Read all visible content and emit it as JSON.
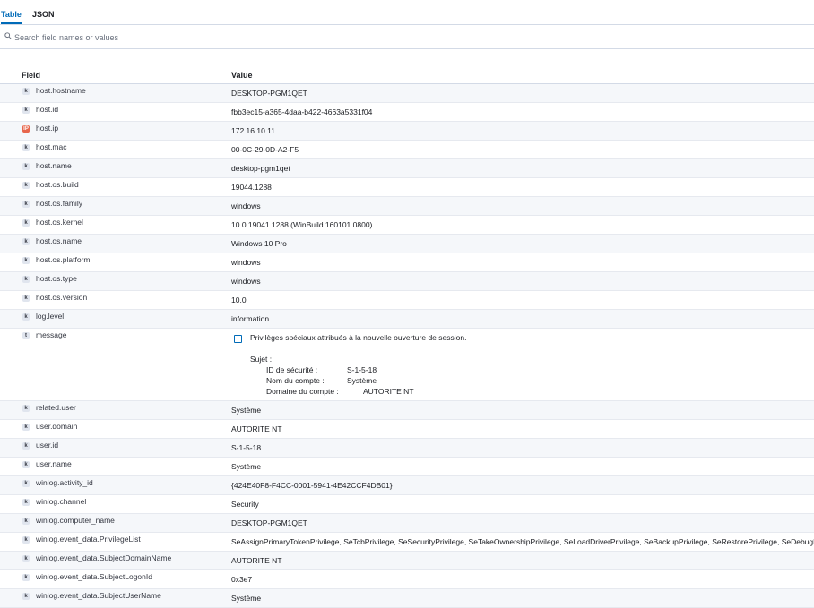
{
  "tabs": [
    {
      "label": "Table",
      "active": true
    },
    {
      "label": "JSON",
      "active": false
    }
  ],
  "search": {
    "placeholder": "Search field names or values",
    "icon": "search-icon"
  },
  "table": {
    "headers": {
      "field": "Field",
      "value": "Value"
    },
    "rows": [
      {
        "type": "k",
        "field": "host.hostname",
        "value": "DESKTOP-PGM1QET"
      },
      {
        "type": "k",
        "field": "host.id",
        "value": "fbb3ec15-a365-4daa-b422-4663a5331f04"
      },
      {
        "type": "IP",
        "field": "host.ip",
        "value": "172.16.10.11"
      },
      {
        "type": "k",
        "field": "host.mac",
        "value": "00-0C-29-0D-A2-F5"
      },
      {
        "type": "k",
        "field": "host.name",
        "value": "desktop-pgm1qet"
      },
      {
        "type": "k",
        "field": "host.os.build",
        "value": "19044.1288"
      },
      {
        "type": "k",
        "field": "host.os.family",
        "value": "windows"
      },
      {
        "type": "k",
        "field": "host.os.kernel",
        "value": "10.0.19041.1288 (WinBuild.160101.0800)"
      },
      {
        "type": "k",
        "field": "host.os.name",
        "value": "Windows 10 Pro"
      },
      {
        "type": "k",
        "field": "host.os.platform",
        "value": "windows"
      },
      {
        "type": "k",
        "field": "host.os.type",
        "value": "windows"
      },
      {
        "type": "k",
        "field": "host.os.version",
        "value": "10.0"
      },
      {
        "type": "k",
        "field": "log.level",
        "value": "information"
      }
    ],
    "message": {
      "type": "t",
      "field": "message",
      "line1": "Privilèges spéciaux attribués à la nouvelle ouverture de session.",
      "subject_label": "Sujet :",
      "entries": [
        {
          "label": "ID de sécurité :",
          "value": "S-1-5-18"
        },
        {
          "label": "Nom du compte :",
          "value": "Système"
        },
        {
          "label": "Domaine du compte :",
          "value": "AUTORITE NT"
        }
      ]
    },
    "rows2": [
      {
        "type": "k",
        "field": "related.user",
        "value": "Système"
      },
      {
        "type": "k",
        "field": "user.domain",
        "value": "AUTORITE NT"
      },
      {
        "type": "k",
        "field": "user.id",
        "value": "S-1-5-18"
      },
      {
        "type": "k",
        "field": "user.name",
        "value": "Système"
      },
      {
        "type": "k",
        "field": "winlog.activity_id",
        "value": "{424E40F8-F4CC-0001-5941-4E42CCF4DB01}"
      },
      {
        "type": "k",
        "field": "winlog.channel",
        "value": "Security"
      },
      {
        "type": "k",
        "field": "winlog.computer_name",
        "value": "DESKTOP-PGM1QET"
      },
      {
        "type": "k",
        "field": "winlog.event_data.PrivilegeList",
        "value": "SeAssignPrimaryTokenPrivilege, SeTcbPrivilege, SeSecurityPrivilege, SeTakeOwnershipPrivilege, SeLoadDriverPrivilege, SeBackupPrivilege, SeRestorePrivilege, SeDebugPr"
      },
      {
        "type": "k",
        "field": "winlog.event_data.SubjectDomainName",
        "value": "AUTORITE NT"
      },
      {
        "type": "k",
        "field": "winlog.event_data.SubjectLogonId",
        "value": "0x3e7"
      },
      {
        "type": "k",
        "field": "winlog.event_data.SubjectUserName",
        "value": "Système"
      }
    ]
  }
}
